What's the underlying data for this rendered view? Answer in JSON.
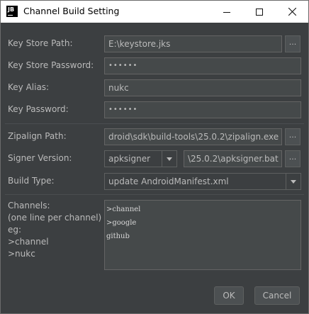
{
  "window": {
    "title": "Channel Build Setting",
    "logo_text": "JB",
    "minimize_icon": "minimize-icon",
    "maximize_icon": "maximize-icon",
    "close_icon": "close-icon"
  },
  "form": {
    "key_store_path": {
      "label": "Key Store Path:",
      "value": "E:\\keystore.jks",
      "browse_label": "..."
    },
    "key_store_password": {
      "label": "Key Store Password:",
      "value": "••••••"
    },
    "key_alias": {
      "label": "Key Alias:",
      "value": "nukc"
    },
    "key_password": {
      "label": "Key Password:",
      "value": "••••••"
    },
    "zipalign_path": {
      "label": "Zipalign Path:",
      "value": "droid\\sdk\\build-tools\\25.0.2\\zipalign.exe",
      "browse_label": "..."
    },
    "signer_version": {
      "label": "Signer Version:",
      "selected": "apksigner",
      "path_value": "\\25.0.2\\apksigner.bat",
      "browse_label": "..."
    },
    "build_type": {
      "label": "Build Type:",
      "selected": "update AndroidManifest.xml"
    },
    "channels": {
      "help_lines": [
        "Channels:",
        "(one line per channel)",
        "eg:",
        ">channel",
        ">nukc"
      ],
      "lines": [
        ">channel",
        ">google",
        "github"
      ]
    }
  },
  "buttons": {
    "ok": "OK",
    "cancel": "Cancel"
  }
}
